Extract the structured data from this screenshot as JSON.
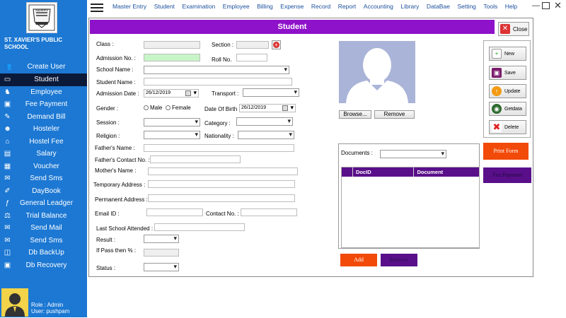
{
  "app": {
    "school_name": "ST. XAVIER'S PUBLIC SCHOOL",
    "logo_text": "XAVIER'S"
  },
  "sidebar": {
    "items": [
      {
        "label": "Create User",
        "icon": "users-icon"
      },
      {
        "label": "Student",
        "icon": "monitor-icon"
      },
      {
        "label": "Employee",
        "icon": "employee-icon"
      },
      {
        "label": "Fee Payment",
        "icon": "fee-icon"
      },
      {
        "label": "Demand Bill",
        "icon": "bill-icon"
      },
      {
        "label": "Hosteler",
        "icon": "hosteler-icon"
      },
      {
        "label": "Hostel Fee",
        "icon": "hostel-icon"
      },
      {
        "label": "Salary",
        "icon": "salary-icon"
      },
      {
        "label": "Voucher",
        "icon": "voucher-icon"
      },
      {
        "label": "Send Sms",
        "icon": "sms-icon"
      },
      {
        "label": "DayBook",
        "icon": "daybook-icon"
      },
      {
        "label": "General Leadger",
        "icon": "ledger-icon"
      },
      {
        "label": "Trial Balance",
        "icon": "balance-icon"
      },
      {
        "label": "Send Mail",
        "icon": "mail-icon"
      },
      {
        "label": "Send Sms",
        "icon": "sms-icon"
      },
      {
        "label": "Db BackUp",
        "icon": "backup-icon"
      },
      {
        "label": "Db Recovery",
        "icon": "recovery-icon"
      }
    ],
    "active_index": 1,
    "user": {
      "role": "Role :  Admin",
      "name": "User:   pushpam"
    }
  },
  "menu": [
    "Master Entry",
    "Student",
    "Examination",
    "Employee",
    "Billing",
    "Expense",
    "Record",
    "Report",
    "Accounting",
    "Library",
    "DataBae",
    "Setting",
    "Tools",
    "Help"
  ],
  "panel": {
    "title": "Student",
    "close_label": "Close"
  },
  "form": {
    "class_label": "Class :",
    "section_label": "Section :",
    "admission_no_label": "Admission No. :",
    "roll_no_label": "Roll No.",
    "school_name_label": "School Name :",
    "student_name_label": "Student Name :",
    "admission_date_label": "Admission Date :",
    "admission_date_value": "26/12/2019",
    "transport_label": "Transport :",
    "gender_label": "Gender :",
    "male_label": "Male",
    "female_label": "Female",
    "dob_label": "Date Of Birth :",
    "dob_value": "26/12/2019",
    "session_label": "Session :",
    "category_label": "Category :",
    "religion_label": "Religion :",
    "nationality_label": "Nationality :",
    "father_name_label": "Father's Name :",
    "father_contact_label": "Father's Contact No. :",
    "mother_name_label": "Mother's Name :",
    "temp_address_label": "Temporary Address :",
    "perm_address_label": "Permanent Address :",
    "email_label": "Email ID :",
    "contact_label": "Contact No. :",
    "last_school_label": "Last School Attended :",
    "result_label": "Result :",
    "if_pass_label": "If Pass then % :",
    "status_label": "Status :"
  },
  "photo": {
    "browse_label": "Browse...",
    "remove_label": "Remove"
  },
  "actions": {
    "new_label": "New",
    "save_label": "Save",
    "update_label": "Update",
    "getdata_label": "Getdata",
    "delete_label": "Delete",
    "print_label": "Print Form",
    "fee_label": "Fee Payment"
  },
  "documents": {
    "label": "Documents :",
    "columns": [
      "DocID",
      "Document"
    ],
    "add_label": "Add",
    "remove_label": "Remove"
  },
  "colors": {
    "sidebar": "#1c78d3",
    "title_bar": "#8e12c9",
    "orange": "#f24a08",
    "purple": "#5a0f8a"
  }
}
